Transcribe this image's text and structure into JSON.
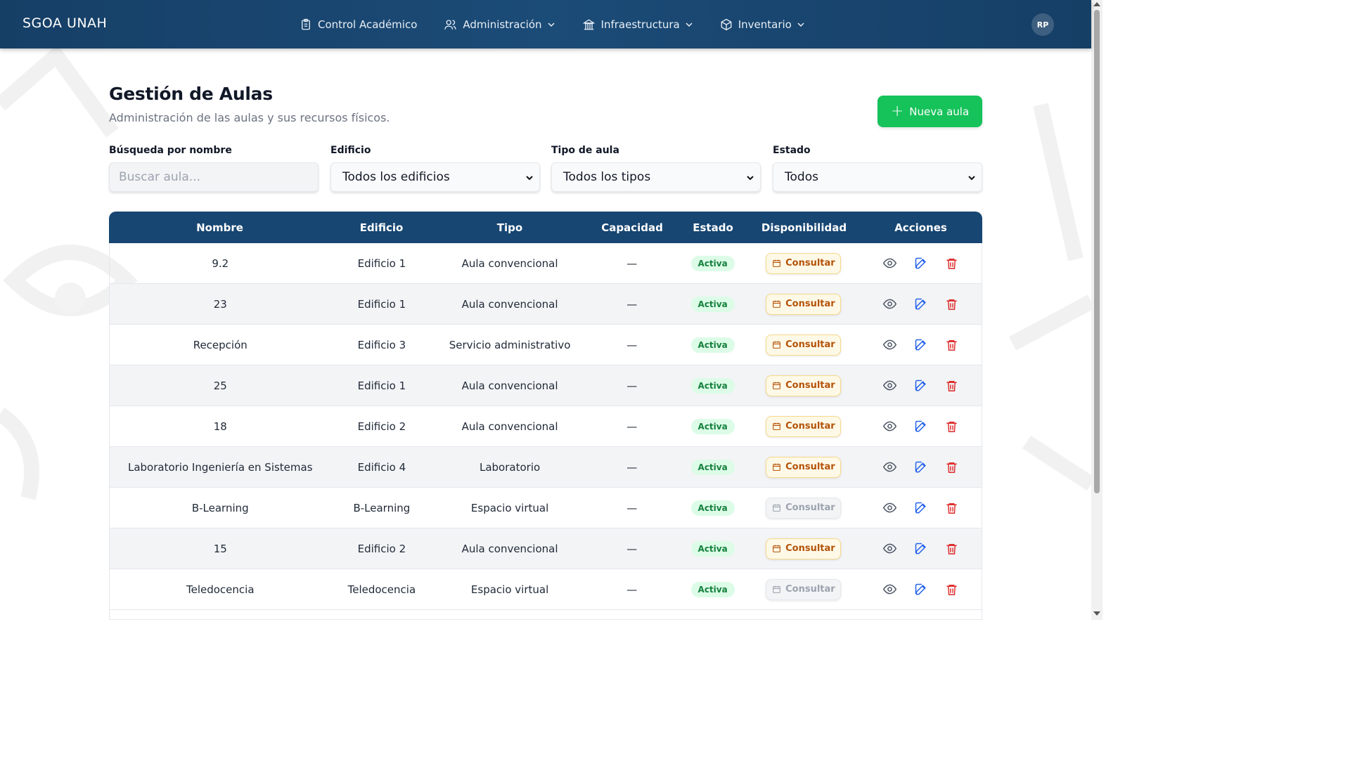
{
  "app": {
    "brand": "SGOA UNAH"
  },
  "nav": {
    "items": [
      {
        "label": "Control Académico",
        "icon": "clipboard-icon",
        "dropdown": false
      },
      {
        "label": "Administración",
        "icon": "users-icon",
        "dropdown": true
      },
      {
        "label": "Infraestructura",
        "icon": "building-icon",
        "dropdown": true
      },
      {
        "label": "Inventario",
        "icon": "box-icon",
        "dropdown": true
      }
    ],
    "avatar_initials": "RP"
  },
  "page": {
    "title": "Gestión de Aulas",
    "subtitle": "Administración de las aulas y sus recursos físicos.",
    "new_button": "Nueva aula"
  },
  "filters": {
    "search": {
      "label": "Búsqueda por nombre",
      "placeholder": "Buscar aula..."
    },
    "building": {
      "label": "Edificio",
      "value": "Todos los edificios"
    },
    "type": {
      "label": "Tipo de aula",
      "value": "Todos los tipos"
    },
    "status": {
      "label": "Estado",
      "value": "Todos"
    }
  },
  "table": {
    "columns": [
      "Nombre",
      "Edificio",
      "Tipo",
      "Capacidad",
      "Estado",
      "Disponibilidad",
      "Acciones"
    ],
    "consult_label": "Consultar",
    "rows": [
      {
        "name": "9.2",
        "building": "Edificio 1",
        "type": "Aula convencional",
        "capacity": "—",
        "status": "Activa",
        "consult_enabled": true
      },
      {
        "name": "23",
        "building": "Edificio 1",
        "type": "Aula convencional",
        "capacity": "—",
        "status": "Activa",
        "consult_enabled": true
      },
      {
        "name": "Recepción",
        "building": "Edificio 3",
        "type": "Servicio administrativo",
        "capacity": "—",
        "status": "Activa",
        "consult_enabled": true
      },
      {
        "name": "25",
        "building": "Edificio 1",
        "type": "Aula convencional",
        "capacity": "—",
        "status": "Activa",
        "consult_enabled": true
      },
      {
        "name": "18",
        "building": "Edificio 2",
        "type": "Aula convencional",
        "capacity": "—",
        "status": "Activa",
        "consult_enabled": true
      },
      {
        "name": "Laboratorio Ingeniería en Sistemas",
        "building": "Edificio 4",
        "type": "Laboratorio",
        "capacity": "—",
        "status": "Activa",
        "consult_enabled": true
      },
      {
        "name": "B-Learning",
        "building": "B-Learning",
        "type": "Espacio virtual",
        "capacity": "—",
        "status": "Activa",
        "consult_enabled": false
      },
      {
        "name": "15",
        "building": "Edificio 2",
        "type": "Aula convencional",
        "capacity": "—",
        "status": "Activa",
        "consult_enabled": true
      },
      {
        "name": "Teledocencia",
        "building": "Teledocencia",
        "type": "Espacio virtual",
        "capacity": "—",
        "status": "Activa",
        "consult_enabled": false
      }
    ]
  },
  "colors": {
    "navbar": "#1b4b77",
    "table_header": "#174672",
    "primary_action": "#16c25a",
    "badge_active_bg": "#dcfce7",
    "badge_active_text": "#15803d",
    "consult_bg": "#fef9e7",
    "consult_text": "#b45309",
    "edit_icon": "#2563eb",
    "delete_icon": "#dc2626"
  }
}
